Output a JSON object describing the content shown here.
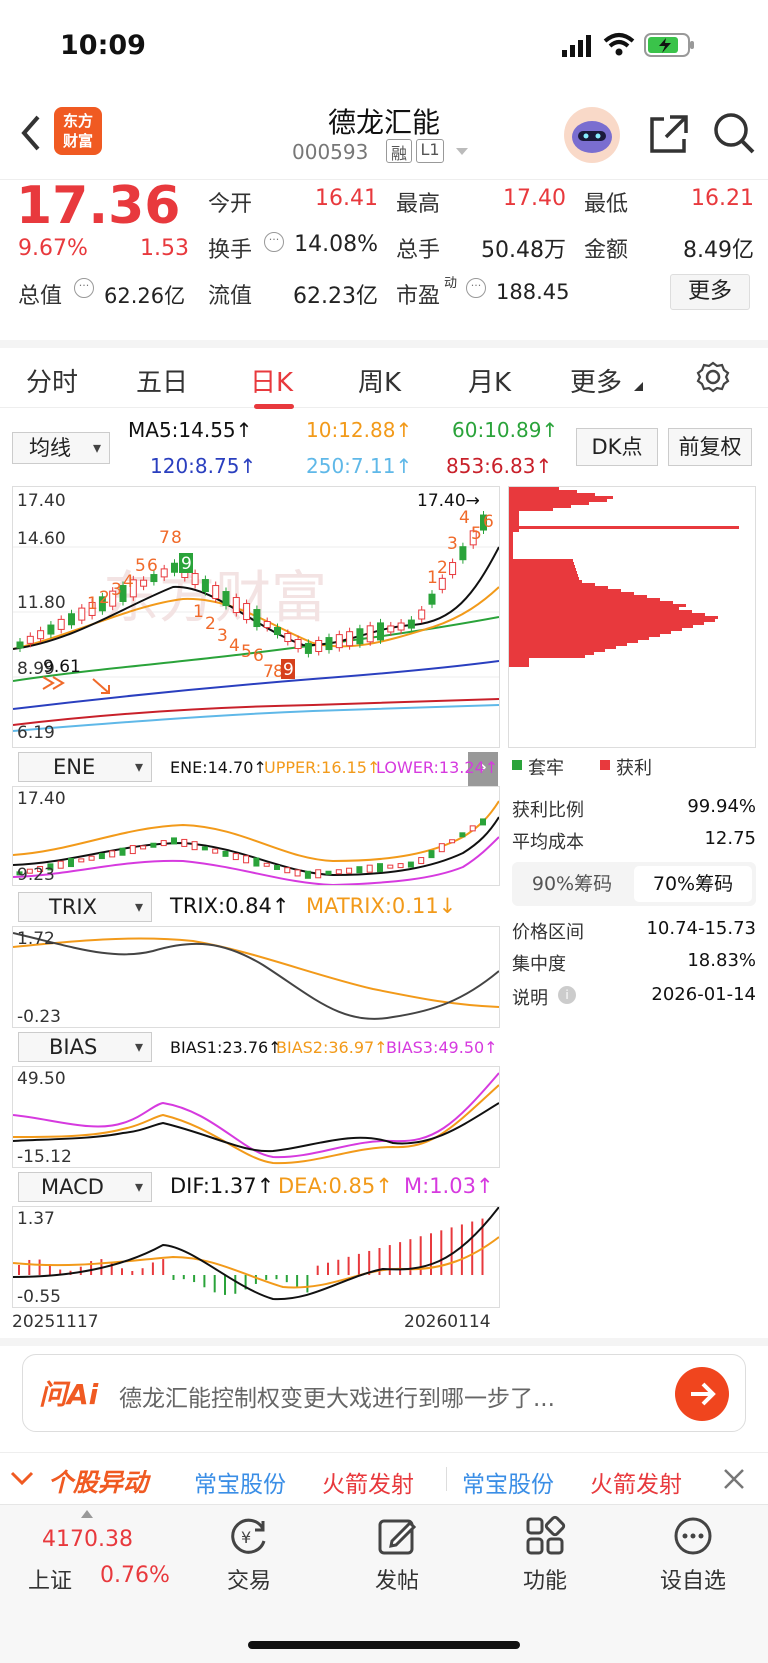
{
  "status": {
    "time": "10:09"
  },
  "header": {
    "title": "德龙汇能",
    "code": "000593",
    "tag_rong": "融",
    "tag_l1": "L1",
    "logo_line1": "东方",
    "logo_line2": "财富"
  },
  "quote": {
    "price": "17.36",
    "change_pct": "9.67%",
    "change": "1.53",
    "open_label": "今开",
    "open": "16.41",
    "high_label": "最高",
    "high": "17.40",
    "low_label": "最低",
    "low": "16.21",
    "turnover_label": "换手",
    "turnover": "14.08%",
    "volume_label": "总手",
    "volume": "50.48万",
    "amount_label": "金额",
    "amount": "8.49亿",
    "mktcap_label": "总值",
    "mktcap": "62.26亿",
    "float_label": "流值",
    "float": "62.23亿",
    "pe_label": "市盈",
    "pe_sup": "动",
    "pe": "188.45",
    "more": "更多"
  },
  "tabs": [
    "分时",
    "五日",
    "日K",
    "周K",
    "月K",
    "更多"
  ],
  "active_tab": "日K",
  "indicators": {
    "ma_select": "均线",
    "ma5": "MA5:14.55↑",
    "ma10": "10:12.88↑",
    "ma60": "60:10.89↑",
    "ma120": "120:8.75↑",
    "ma250": "250:7.11↑",
    "ma853": "853:6.83↑",
    "dk_button": "DK点",
    "fq_button": "前复权"
  },
  "main_chart": {
    "y_top": "17.40",
    "y_mid1": "14.60",
    "y_mid2": "11.80",
    "y_low": "8.99",
    "y_low2": "9.61",
    "y_bottom": "6.19",
    "high_mark": "17.40→",
    "td_up_left": [
      "1",
      "2",
      "3",
      "4",
      "5",
      "6",
      "7",
      "8",
      "9"
    ],
    "td_down": [
      "1",
      "2",
      "3",
      "4",
      "5",
      "6",
      "7",
      "8",
      "9"
    ],
    "td_up_right": [
      "1",
      "2",
      "3",
      "4",
      "5",
      "6"
    ],
    "watermark": "东方财富"
  },
  "ene": {
    "select": "ENE",
    "ene": "ENE:14.70↑",
    "upper": "UPPER:16.15↑",
    "lower": "LOWER:13.24↑",
    "y_top": "17.40",
    "y_bottom": "9.23"
  },
  "trix": {
    "select": "TRIX",
    "trix": "TRIX:0.84↑",
    "matrix": "MATRIX:0.11↓",
    "y_top": "1.72",
    "y_bottom": "-0.23"
  },
  "bias": {
    "select": "BIAS",
    "bias1": "BIAS1:23.76↑",
    "bias2": "BIAS2:36.97↑",
    "bias3": "BIAS3:49.50↑",
    "y_top": "49.50",
    "y_bottom": "-15.12"
  },
  "macd": {
    "select": "MACD",
    "dif": "DIF:1.37↑",
    "dea": "DEA:0.85↑",
    "m": "M:1.03↑",
    "y_top": "1.37",
    "y_bottom": "-0.55",
    "date_start": "20251117",
    "date_end": "20260114"
  },
  "chip": {
    "legend_solid": "套牢",
    "legend_profit": "获利",
    "profit_ratio_label": "获利比例",
    "profit_ratio": "99.94%",
    "avg_cost_label": "平均成本",
    "avg_cost": "12.75",
    "tab90": "90%筹码",
    "tab70": "70%筹码",
    "range_label": "价格区间",
    "range": "10.74-15.73",
    "concentration_label": "集中度",
    "concentration": "18.83%",
    "note_label": "说明",
    "note_date": "2026-01-14"
  },
  "ai": {
    "logo": "问Ai",
    "prompt": "德龙汇能控制权变更大戏进行到哪一步了..."
  },
  "ticker": {
    "title": "个股异动",
    "items": [
      "常宝股份",
      "火箭发射",
      "常宝股份",
      "火箭发射"
    ]
  },
  "bottom": {
    "index_value": "4170.38",
    "index_name": "上证",
    "index_pct": "0.76%",
    "trade": "交易",
    "post": "发帖",
    "func": "功能",
    "watch": "设自选"
  }
}
